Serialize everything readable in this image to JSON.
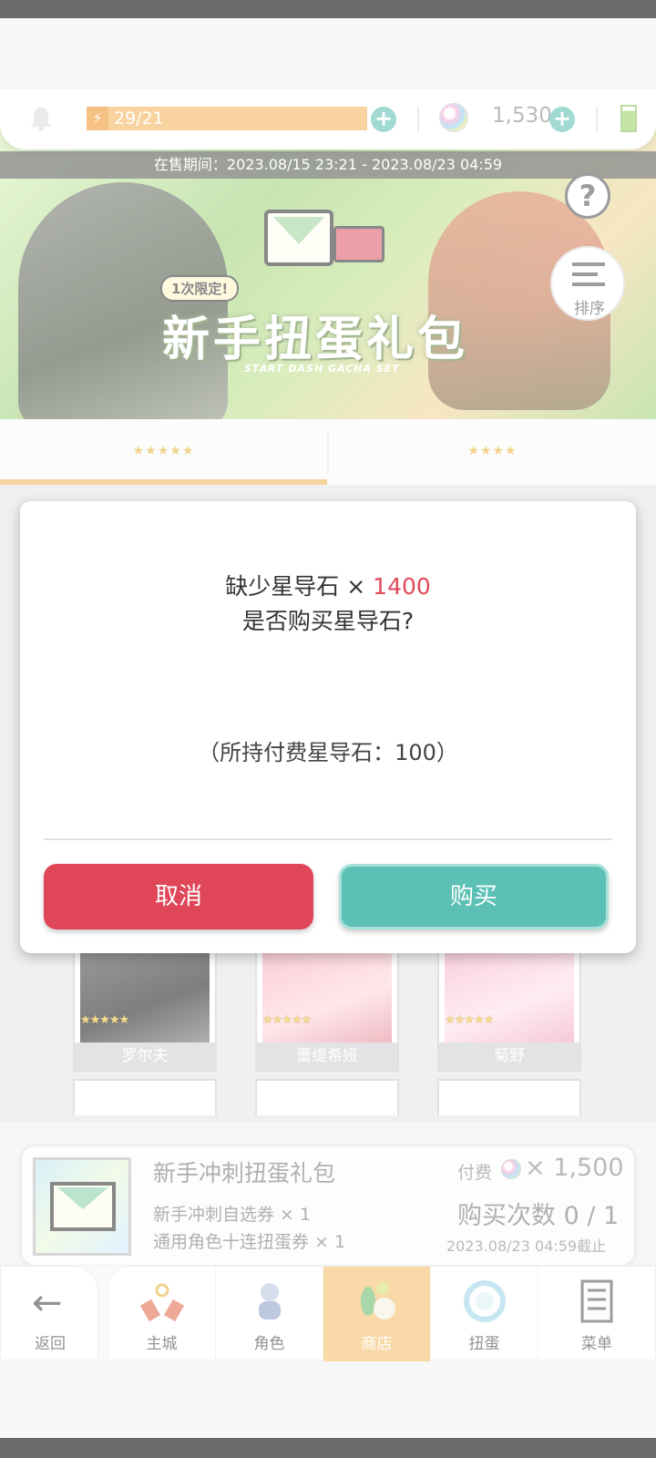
{
  "topbar": {
    "stamina": "29/21",
    "gem_count": "1,530"
  },
  "banner": {
    "sale_period": "在售期间：2023.08/15 23:21 - 2023.08/23 04:59",
    "limited_tag": "1次限定!",
    "title": "新手扭蛋礼包",
    "subtitle": "START DASH GACHA SET",
    "help_icon": "?",
    "sort_label": "排序"
  },
  "tabs": [
    {
      "label": "★★★★★",
      "active": true
    },
    {
      "label": "★★★★",
      "active": false
    }
  ],
  "characters": [
    {
      "name": "罗尔夫",
      "stars": "★★★★★"
    },
    {
      "name": "蕾缇希娅",
      "stars": "★★★★★"
    },
    {
      "name": "菊野",
      "stars": "★★★★★"
    }
  ],
  "product": {
    "title": "新手冲刺扭蛋礼包",
    "line1": "新手冲刺自选券 × 1",
    "line2": "通用角色十连扭蛋券 × 1",
    "price_label": "付费",
    "price": "× 1,500",
    "count": "购买次数 0 / 1",
    "deadline": "2023.08/23 04:59截止"
  },
  "nav": {
    "back": "返回",
    "items": [
      {
        "label": "主城",
        "icon": "castle-icon"
      },
      {
        "label": "角色",
        "icon": "character-icon"
      },
      {
        "label": "商店",
        "icon": "shop-icon",
        "active": true
      },
      {
        "label": "扭蛋",
        "icon": "gacha-icon"
      },
      {
        "label": "菜单",
        "icon": "menu-icon"
      }
    ]
  },
  "dialog": {
    "line1_prefix": "缺少星导石",
    "line1_times": "×",
    "line1_qty": "1400",
    "line2": "是否购买星导石?",
    "line3": "（所持付费星导石：100）",
    "cancel": "取消",
    "buy": "购买"
  },
  "colors": {
    "accent_teal": "#5cc0b4",
    "cancel_red": "#df4658",
    "tab_gold": "#f0b558",
    "highlight_red": "#e04a5a"
  }
}
